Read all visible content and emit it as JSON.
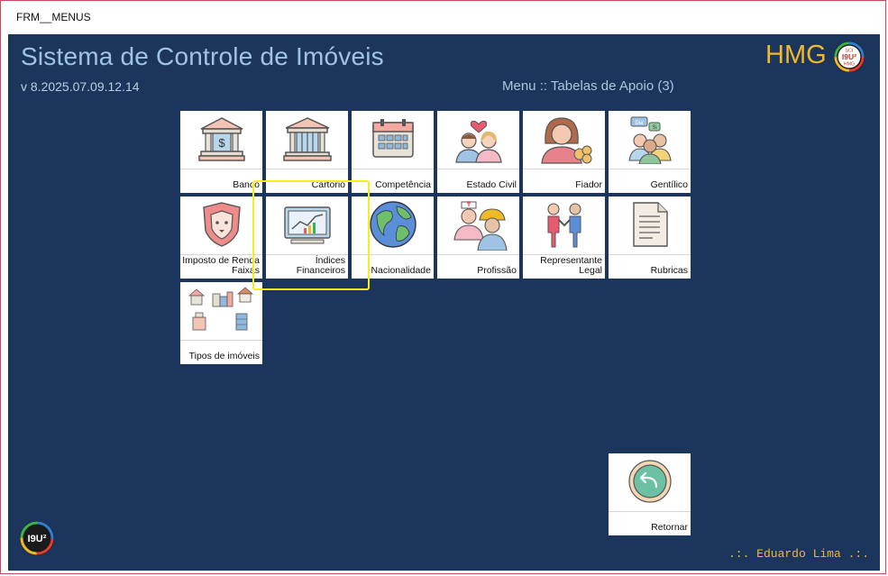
{
  "window": {
    "title": "FRM__MENUS"
  },
  "header": {
    "app_title": "Sistema de Controle de Imóveis",
    "version": "v 8.2025.07.09.12.14",
    "menu_path": "Menu :: Tabelas de Apoio (3)",
    "brand": "HMG",
    "logo_text": "I9U²",
    "logo_sub_top": "SCI",
    "logo_sub_bottom": "HMG"
  },
  "tiles": [
    {
      "label": "Banco",
      "icon": "bank-icon"
    },
    {
      "label": "Cartório",
      "icon": "registry-office-icon"
    },
    {
      "label": "Competência",
      "icon": "calendar-icon"
    },
    {
      "label": "Estado Civil",
      "icon": "couple-icon"
    },
    {
      "label": "Fiador",
      "icon": "guarantor-icon"
    },
    {
      "label": "Gentílico",
      "icon": "people-talking-icon"
    },
    {
      "label": "Imposto de Renda\nFaixas",
      "icon": "lion-shield-icon"
    },
    {
      "label": "Índices\nFinanceiros",
      "icon": "financial-chart-icon"
    },
    {
      "label": "Nacionalidade",
      "icon": "globe-icon"
    },
    {
      "label": "Profissão",
      "icon": "professionals-icon"
    },
    {
      "label": "Representante\nLegal",
      "icon": "handshake-people-icon"
    },
    {
      "label": "Rubricas",
      "icon": "document-icon"
    },
    {
      "label": "Tipos de imóveis",
      "icon": "buildings-icon"
    }
  ],
  "return_tile": {
    "label": "Retornar",
    "icon": "back-arrow-icon"
  },
  "footer": {
    "user": ".:. Eduardo Lima .:.",
    "logo_text": "I9U²"
  },
  "colors": {
    "background": "#1c355d",
    "accent": "#f0b928",
    "title": "#9fc4e2",
    "highlight": "#f5f018"
  }
}
